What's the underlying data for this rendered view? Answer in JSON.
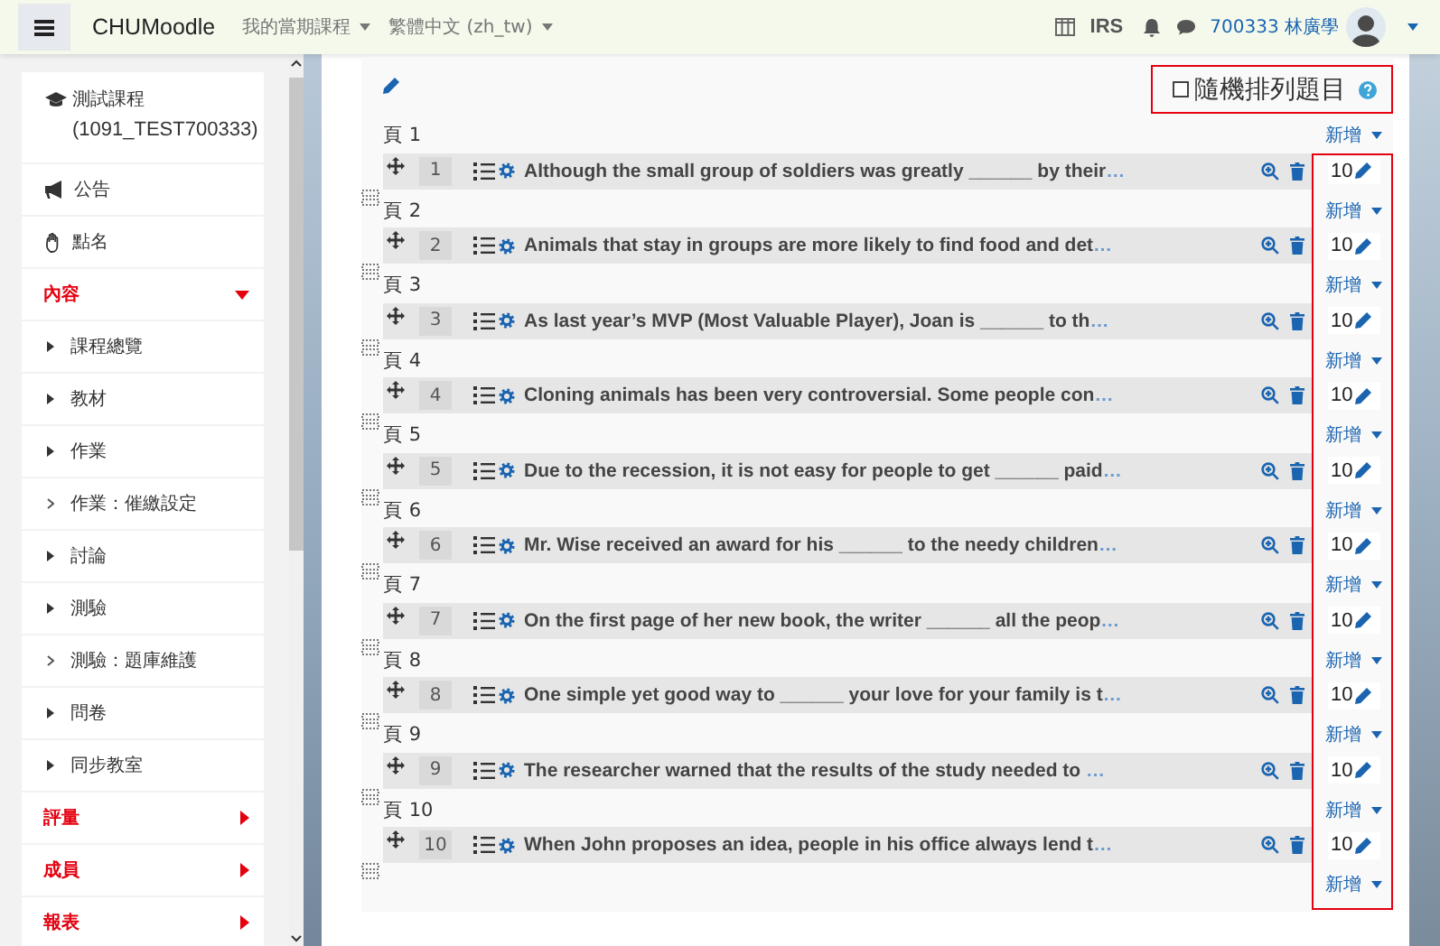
{
  "navbar": {
    "brand": "CHUMoodle",
    "menus": [
      {
        "label": "我的當期課程"
      },
      {
        "label": "繁體中文 (zh_tw)"
      }
    ],
    "irs": "IRS",
    "user": "700333 林廣學"
  },
  "sidebar": {
    "course": {
      "title": "測試課程",
      "code": "(1091_TEST700333)"
    },
    "items": [
      {
        "kind": "link",
        "label": "公告"
      },
      {
        "kind": "link",
        "label": "點名"
      },
      {
        "kind": "section",
        "label": "內容",
        "expanded": true,
        "children": [
          {
            "kind": "activity",
            "label": "課程總覽"
          },
          {
            "kind": "activity",
            "label": "教材"
          },
          {
            "kind": "activity",
            "label": "作業"
          },
          {
            "kind": "setting",
            "label": "作業：催繳設定"
          },
          {
            "kind": "activity",
            "label": "討論"
          },
          {
            "kind": "activity",
            "label": "測驗"
          },
          {
            "kind": "setting",
            "label": "測驗：題庫維護"
          },
          {
            "kind": "activity",
            "label": "問卷"
          },
          {
            "kind": "activity",
            "label": "同步教室"
          }
        ]
      },
      {
        "kind": "section",
        "label": "評量",
        "expanded": false
      },
      {
        "kind": "section",
        "label": "成員",
        "expanded": false
      },
      {
        "kind": "section",
        "label": "報表",
        "expanded": false
      }
    ]
  },
  "quiz": {
    "shuffle": {
      "label": "隨機排列題目",
      "checked": false
    },
    "pages": [
      {
        "label": "頁 1",
        "add": "新增",
        "question": {
          "number": "1",
          "text": "Although the small group of soldiers was greatly ______ by their",
          "more": "…",
          "mark": "10"
        }
      },
      {
        "label": "頁 2",
        "add": "新增",
        "question": {
          "number": "2",
          "text": "Animals that stay in groups are more likely to find food and det",
          "more": "…",
          "mark": "10"
        }
      },
      {
        "label": "頁 3",
        "add": "新增",
        "question": {
          "number": "3",
          "text": "As last year’s MVP (Most Valuable Player), Joan is ______ to th",
          "more": "…",
          "mark": "10"
        }
      },
      {
        "label": "頁 4",
        "add": "新增",
        "question": {
          "number": "4",
          "text": "Cloning animals has been very controversial. Some people con",
          "more": "…",
          "mark": "10"
        }
      },
      {
        "label": "頁 5",
        "add": "新增",
        "question": {
          "number": "5",
          "text": "Due to the recession, it is not easy for people to get ______ paid",
          "more": "…",
          "mark": "10"
        }
      },
      {
        "label": "頁 6",
        "add": "新增",
        "question": {
          "number": "6",
          "text": "Mr. Wise received an award for his ______ to the needy children",
          "more": "…",
          "mark": "10"
        }
      },
      {
        "label": "頁 7",
        "add": "新增",
        "question": {
          "number": "7",
          "text": "On the first page of her new book, the writer ______ all the peop",
          "more": "…",
          "mark": "10"
        }
      },
      {
        "label": "頁 8",
        "add": "新增",
        "question": {
          "number": "8",
          "text": "One simple yet good way to ______ your love for your family is t",
          "more": "…",
          "mark": "10"
        }
      },
      {
        "label": "頁 9",
        "add": "新增",
        "question": {
          "number": "9",
          "text": "The researcher warned that the results of the study needed to ",
          "more": "…",
          "mark": "10"
        }
      },
      {
        "label": "頁 10",
        "add": "新增",
        "question": {
          "number": "10",
          "text": "When John proposes an idea, people in his office always lend t",
          "more": "…",
          "mark": "10"
        }
      }
    ],
    "final_add": "新增"
  }
}
